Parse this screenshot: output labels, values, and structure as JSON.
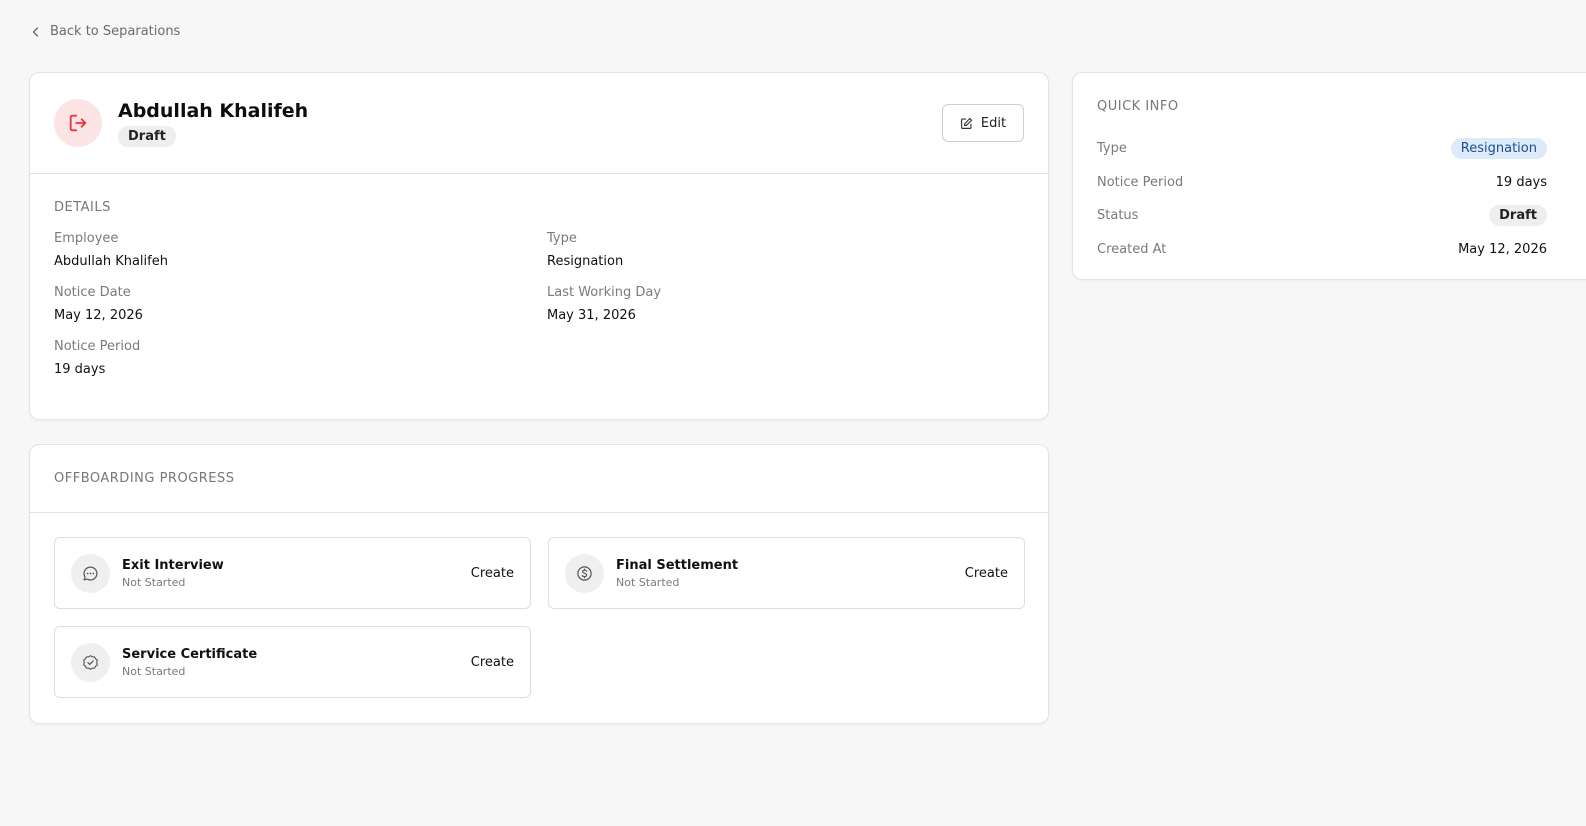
{
  "back_link": {
    "label": "Back to Separations"
  },
  "header": {
    "name": "Abdullah Khalifeh",
    "status_badge": "Draft",
    "edit_label": "Edit"
  },
  "details": {
    "section_title": "DETAILS",
    "fields": {
      "employee": {
        "label": "Employee",
        "value": "Abdullah Khalifeh"
      },
      "type": {
        "label": "Type",
        "value": "Resignation"
      },
      "notice_date": {
        "label": "Notice Date",
        "value": "May 12, 2026"
      },
      "last_working_day": {
        "label": "Last Working Day",
        "value": "May 31, 2026"
      },
      "notice_period": {
        "label": "Notice Period",
        "value": "19 days"
      }
    }
  },
  "offboarding": {
    "section_title": "OFFBOARDING PROGRESS",
    "tasks": [
      {
        "title": "Exit Interview",
        "status": "Not Started",
        "action": "Create",
        "icon": "chat-icon"
      },
      {
        "title": "Final Settlement",
        "status": "Not Started",
        "action": "Create",
        "icon": "dollar-icon"
      },
      {
        "title": "Service Certificate",
        "status": "Not Started",
        "action": "Create",
        "icon": "check-circle-icon"
      }
    ]
  },
  "quick_info": {
    "section_title": "QUICK INFO",
    "type": {
      "label": "Type",
      "value": "Resignation"
    },
    "notice_period": {
      "label": "Notice Period",
      "value": "19 days"
    },
    "status": {
      "label": "Status",
      "value": "Draft"
    },
    "created_at": {
      "label": "Created At",
      "value": "May 12, 2026"
    }
  },
  "colors": {
    "background": "#f7f7f7",
    "accent_red": "#e5383b",
    "type_badge_bg": "#dceafa",
    "type_badge_text": "#1d4f8f"
  }
}
